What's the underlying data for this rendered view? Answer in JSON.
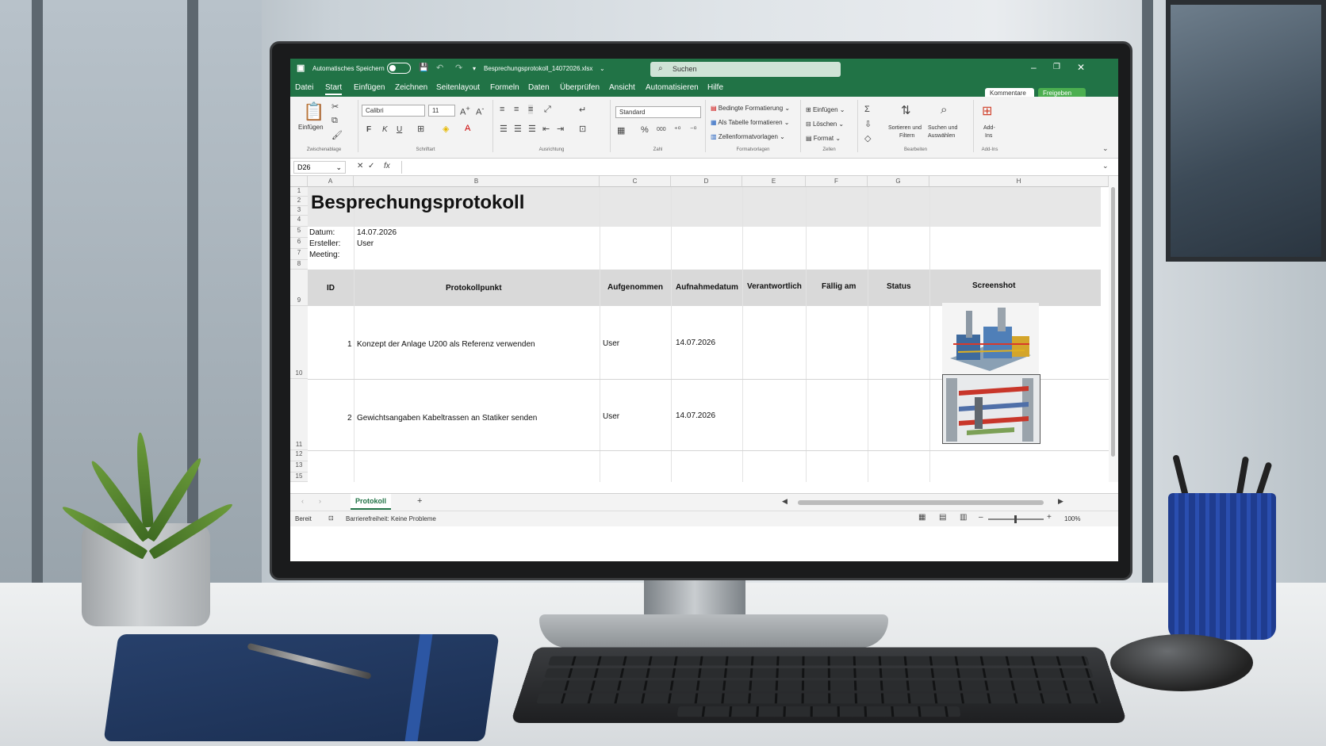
{
  "titlebar": {
    "autosave": "Automatisches Speichern",
    "filename": "Besprechungsprotokoll_14072026.xlsx",
    "search_placeholder": "Suchen"
  },
  "menu": {
    "items": [
      "Datei",
      "Start",
      "Einfügen",
      "Zeichnen",
      "Seitenlayout",
      "Formeln",
      "Daten",
      "Überprüfen",
      "Ansicht",
      "Automatisieren",
      "Hilfe"
    ],
    "comments": "Kommentare",
    "share": "Freigeben"
  },
  "ribbon": {
    "clipboard": {
      "paste": "Einfügen",
      "label": "Zwischenablage"
    },
    "font": {
      "name": "Calibri",
      "size": "11",
      "bold": "F",
      "italic": "K",
      "underline": "U",
      "label": "Schriftart"
    },
    "alignment": {
      "label": "Ausrichtung"
    },
    "number": {
      "format": "Standard",
      "percent": "%",
      "thousands": "000",
      "label": "Zahl"
    },
    "styles": {
      "conditional": "Bedingte Formatierung",
      "as_table": "Als Tabelle formatieren",
      "cell_styles": "Zellenformatvorlagen",
      "label": "Formatvorlagen"
    },
    "cells": {
      "insert": "Einfügen",
      "delete": "Löschen",
      "format": "Format",
      "label": "Zellen"
    },
    "editing": {
      "sort_line1": "Sortieren und",
      "sort_line2": "Filtern",
      "find_line1": "Suchen und",
      "find_line2": "Auswählen",
      "label": "Bearbeiten"
    },
    "addins": {
      "line1": "Add-",
      "line2": "Ins",
      "label": "Add-Ins"
    }
  },
  "formula": {
    "namebox": "D26",
    "fx": "fx",
    "value": ""
  },
  "columns": [
    "A",
    "B",
    "C",
    "D",
    "E",
    "F",
    "G",
    "H"
  ],
  "rows": [
    "1",
    "2",
    "3",
    "4",
    "5",
    "6",
    "7",
    "8",
    "9",
    "10",
    "11",
    "12",
    "13",
    "15"
  ],
  "sheet": {
    "title": "Besprechungsprotokoll",
    "meta": [
      {
        "label": "Datum:",
        "value": "14.07.2026"
      },
      {
        "label": "Ersteller:",
        "value": "User"
      },
      {
        "label": "Meeting:",
        "value": ""
      }
    ],
    "headers": [
      "ID",
      "Protokollpunkt",
      "Aufgenommen",
      "Aufnahmedatum",
      "Verantwortlich",
      "Fällig am",
      "Status",
      "Screenshot"
    ],
    "entries": [
      {
        "id": "1",
        "text": "Konzept der Anlage U200 als Referenz verwenden",
        "by": "User",
        "date": "14.07.2026",
        "image": "plant-3d-model"
      },
      {
        "id": "2",
        "text": "Gewichtsangaben Kabeltrassen an Statiker senden",
        "by": "User",
        "date": "14.07.2026",
        "image": "cable-tray-3d-model"
      }
    ]
  },
  "tabs": {
    "active": "Protokoll",
    "add": "+"
  },
  "status": {
    "ready": "Bereit",
    "accessibility": "Barrierefreiheit: Keine Probleme",
    "zoom": "100%"
  },
  "colors": {
    "excel_green": "#217346",
    "header_band": "#d9d9d9"
  }
}
